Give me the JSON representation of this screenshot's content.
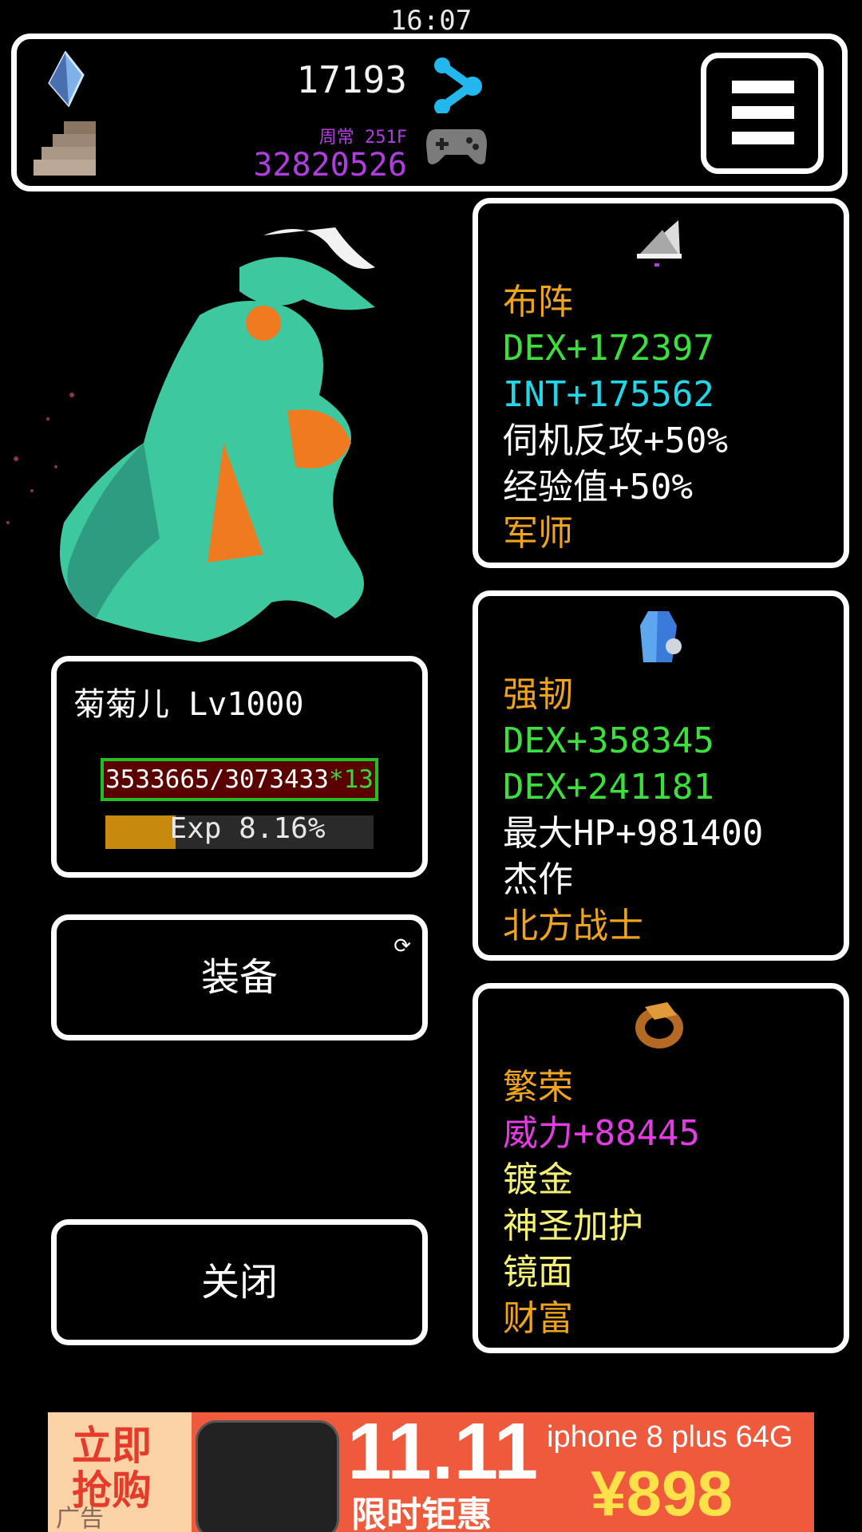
{
  "status_bar": {
    "time": "16:07"
  },
  "header": {
    "gold": "17193",
    "mode_label": "周常 251F",
    "floor_score": "32820526"
  },
  "character": {
    "name_level": "菊菊儿 Lv1000",
    "hp_text": "3533665/3073433",
    "hp_multiplier": "*13",
    "exp_label": "Exp 8.16%",
    "exp_fraction": 0.0816
  },
  "buttons": {
    "equip_label": "装备",
    "close_label": "关闭"
  },
  "items": [
    {
      "icon": "fan-icon",
      "lines": [
        {
          "text": "布阵",
          "color": "orange"
        },
        {
          "text": "DEX+172397",
          "color": "green"
        },
        {
          "text": "INT+175562",
          "color": "cyan"
        },
        {
          "text": "伺机反攻+50%",
          "color": "white"
        },
        {
          "text": "经验值+50%",
          "color": "white"
        },
        {
          "text": "军师",
          "color": "orange"
        }
      ]
    },
    {
      "icon": "armor-icon",
      "lines": [
        {
          "text": "强韧",
          "color": "orange"
        },
        {
          "text": "DEX+358345",
          "color": "green"
        },
        {
          "text": "DEX+241181",
          "color": "green"
        },
        {
          "text": "最大HP+981400",
          "color": "white"
        },
        {
          "text": "杰作",
          "color": "white"
        },
        {
          "text": "北方战士",
          "color": "orange"
        }
      ]
    },
    {
      "icon": "ring-icon",
      "lines": [
        {
          "text": "繁荣",
          "color": "orange"
        },
        {
          "text": "威力+88445",
          "color": "magenta"
        },
        {
          "text": "镀金",
          "color": "yellow"
        },
        {
          "text": "神圣加护",
          "color": "yellow"
        },
        {
          "text": "镜面",
          "color": "yellow"
        },
        {
          "text": "财富",
          "color": "orange"
        }
      ]
    }
  ],
  "ad": {
    "grab_now": "立即抢购",
    "date": "11.11",
    "sale": "限时钜惠",
    "model": "iphone 8 plus  64G",
    "price": "¥898",
    "tag": "广告"
  }
}
